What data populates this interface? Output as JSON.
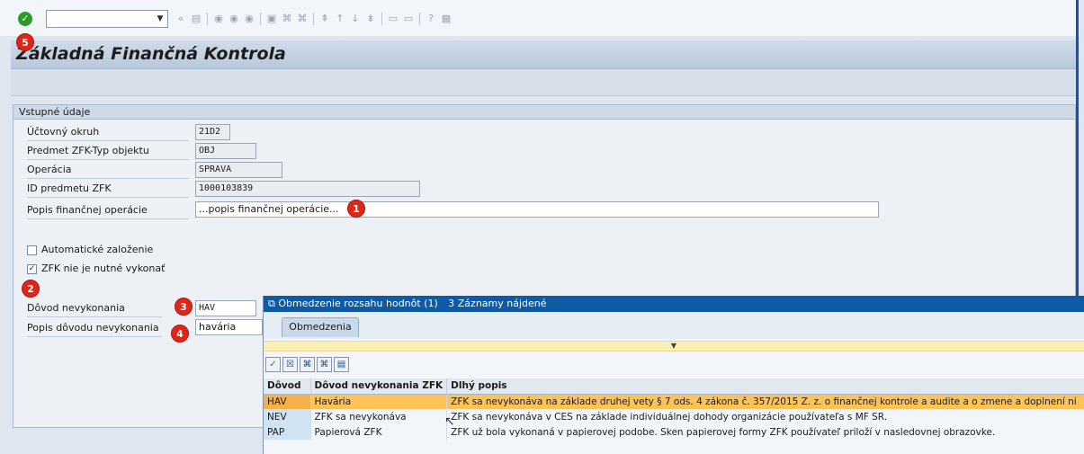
{
  "window": {
    "title": "Základná Finančná Kontrola",
    "toolbar_icons": [
      "enter-icon",
      "back-icon",
      "save-icon",
      "back-nav-icon",
      "exit-icon",
      "cancel-icon",
      "print-icon",
      "find-icon",
      "find-next-icon",
      "first-page-icon",
      "prev-page-icon",
      "next-page-icon",
      "last-page-icon",
      "new-session-icon",
      "shortcut-icon",
      "help-icon",
      "settings-icon"
    ]
  },
  "markers": [
    "1",
    "2",
    "3",
    "4",
    "5"
  ],
  "form": {
    "section_title": "Vstupné údaje",
    "fields": [
      {
        "label": "Účtovný okruh",
        "value": "21D2"
      },
      {
        "label": "Predmet ZFK-Typ objektu",
        "value": "OBJ"
      },
      {
        "label": "Operácia",
        "value": "SPRAVA"
      },
      {
        "label": "ID predmetu ZFK",
        "value": "1000103839"
      },
      {
        "label": "Popis finančnej operácie",
        "value": "...popis finančnej operácie..."
      }
    ],
    "checkboxes": [
      {
        "label": "Automatické založenie",
        "checked": false
      },
      {
        "label": "ZFK nie je nutné vykonať",
        "checked": true
      }
    ],
    "reason_label": "Dôvod nevykonania",
    "reason_value": "HAV",
    "reason_desc_label": "Popis dôvodu nevykonania",
    "reason_desc_value": "havária"
  },
  "popup": {
    "title": "Obmedzenie rozsahu hodnôt (1)",
    "count": "3 Záznamy nájdené",
    "tab": "Obmedzenia",
    "columns": [
      "Dôvod",
      "Dôvod nevykonania ZFK",
      "Dlhý popis"
    ],
    "rows": [
      {
        "code": "HAV",
        "name": "Havária",
        "desc": "ZFK sa nevykonáva na základe druhej vety § 7 ods. 4 zákona č. 357/2015 Z. z. o finančnej kontrole a audite a o zmene a doplnení ni",
        "selected": true
      },
      {
        "code": "NEV",
        "name": "ZFK sa nevykonáva",
        "desc": "ZFK sa nevykonáva v CES na základe individuálnej dohody organizácie používateľa s MF SR.",
        "selected": false
      },
      {
        "code": "PAP",
        "name": "Papierová ZFK",
        "desc": "ZFK už bola vykonaná v papierovej podobe. Sken papierovej formy ZFK používateľ priloží v nasledovnej obrazovke.",
        "selected": false
      }
    ]
  }
}
